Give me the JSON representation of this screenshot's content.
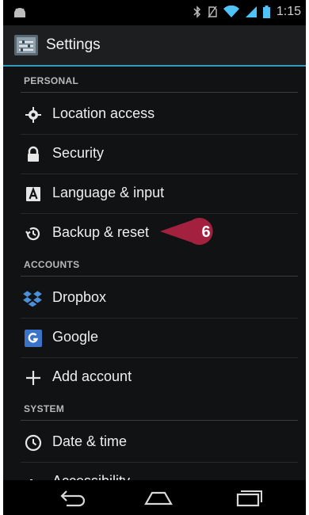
{
  "status_bar": {
    "time": "1:15"
  },
  "action_bar": {
    "title": "Settings",
    "icon": "settings-app-icon"
  },
  "sections": [
    {
      "header": "PERSONAL",
      "items": [
        {
          "label": "Location access",
          "icon": "location-icon"
        },
        {
          "label": "Security",
          "icon": "lock-icon"
        },
        {
          "label": "Language & input",
          "icon": "language-icon"
        },
        {
          "label": "Backup & reset",
          "icon": "backup-icon"
        }
      ]
    },
    {
      "header": "ACCOUNTS",
      "items": [
        {
          "label": "Dropbox",
          "icon": "dropbox-icon"
        },
        {
          "label": "Google",
          "icon": "google-icon"
        },
        {
          "label": "Add account",
          "icon": "plus-icon"
        }
      ]
    },
    {
      "header": "SYSTEM",
      "items": [
        {
          "label": "Date & time",
          "icon": "clock-icon"
        },
        {
          "label": "Accessibility",
          "icon": "accessibility-icon"
        }
      ]
    }
  ],
  "callout": {
    "number": "6",
    "color": "#a3213f"
  },
  "nav_bar": {
    "back": "back-icon",
    "home": "home-icon",
    "recents": "recents-icon"
  }
}
